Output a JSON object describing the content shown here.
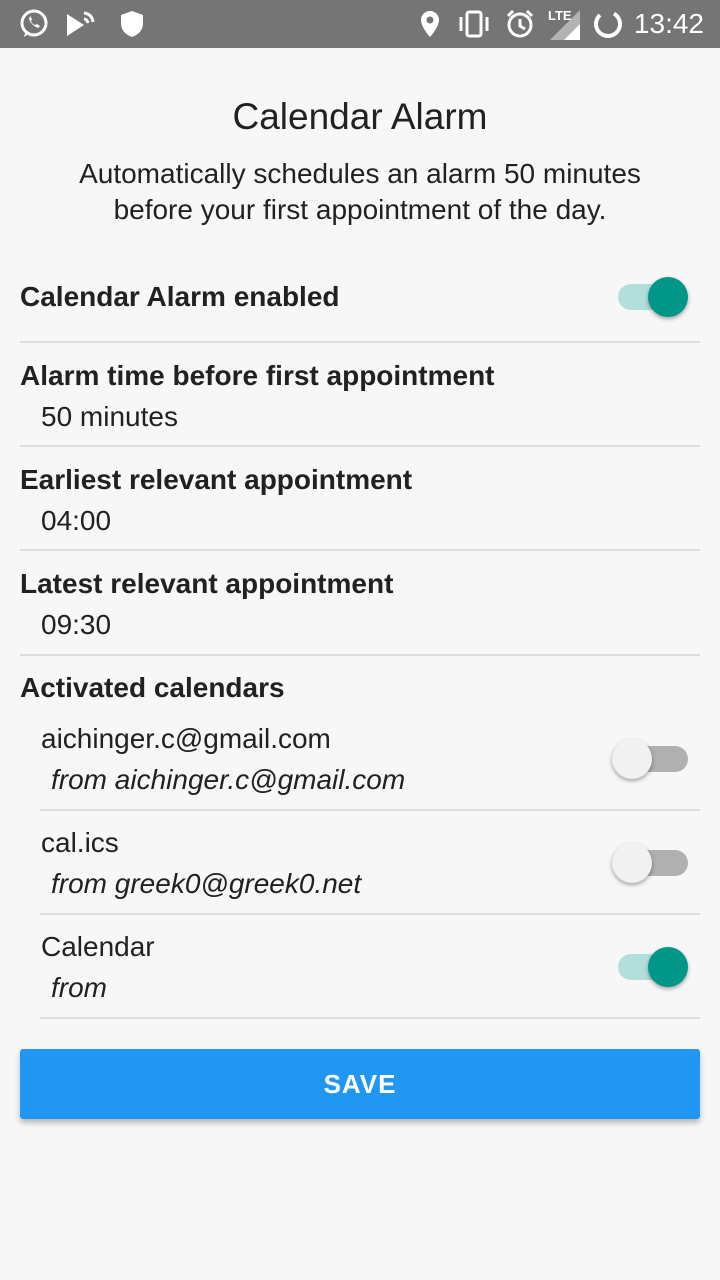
{
  "status_bar": {
    "time": "13:42",
    "network": "LTE",
    "icons": [
      "whatsapp-icon",
      "cast-icon",
      "shield-icon",
      "location-icon",
      "vibrate-icon",
      "alarm-icon",
      "signal-icon",
      "battery-charging-icon"
    ]
  },
  "header": {
    "title": "Calendar Alarm",
    "subtitle_line1": "Automatically schedules an alarm 50 minutes",
    "subtitle_line2": "before your first appointment of the day."
  },
  "settings": {
    "enabled": {
      "label": "Calendar Alarm enabled",
      "on": true
    },
    "alarm_time": {
      "label": "Alarm time before first appointment",
      "value": "50 minutes"
    },
    "earliest": {
      "label": "Earliest relevant appointment",
      "value": "04:00"
    },
    "latest": {
      "label": "Latest relevant appointment",
      "value": "09:30"
    },
    "activated_label": "Activated calendars"
  },
  "calendars": [
    {
      "name": "aichinger.c@gmail.com",
      "from": "from aichinger.c@gmail.com",
      "on": false
    },
    {
      "name": "cal.ics",
      "from": "from greek0@greek0.net",
      "on": false
    },
    {
      "name": "Calendar",
      "from": "from",
      "on": true
    }
  ],
  "save_label": "SAVE",
  "colors": {
    "status_bar": "#757575",
    "accent": "#009688",
    "accent_track": "#b2dfdb",
    "button": "#2196f3",
    "background": "#f7f7f7"
  }
}
